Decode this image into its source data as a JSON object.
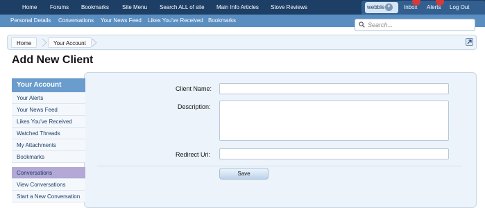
{
  "topnav": {
    "items": [
      "Home",
      "Forums",
      "Bookmarks",
      "Site Menu",
      "Search ALL of site",
      "Main Info Articles",
      "Stove Reviews"
    ],
    "user": "webble",
    "inbox": "Inbox",
    "alerts": "Alerts",
    "logout": "Log Out"
  },
  "subnav": {
    "items": [
      "Personal Details",
      "Conversations",
      "Your News Feed",
      "Likes You've Received",
      "Bookmarks"
    ]
  },
  "search": {
    "placeholder": "Search..."
  },
  "breadcrumb": [
    "Home",
    "Your Account"
  ],
  "page_title": "Add New Client",
  "sidebar": {
    "heading": "Your Account",
    "items": [
      "Your Alerts",
      "Your News Feed",
      "Likes You've Received",
      "Watched Threads",
      "My Attachments",
      "Bookmarks"
    ],
    "section2": [
      "Conversations",
      "View Conversations",
      "Start a New Conversation"
    ]
  },
  "form": {
    "client_name_label": "Client Name:",
    "client_name_value": "",
    "description_label": "Description:",
    "description_value": "",
    "redirect_label": "Redirect Uri:",
    "redirect_value": "",
    "save_label": "Save"
  },
  "colors": {
    "nav_dark": "#1d3f66",
    "nav_light": "#5a8ec1",
    "sidebar_head": "#6a9ccd",
    "active_item": "#b3a8d6",
    "badge": "#d43a3a"
  }
}
